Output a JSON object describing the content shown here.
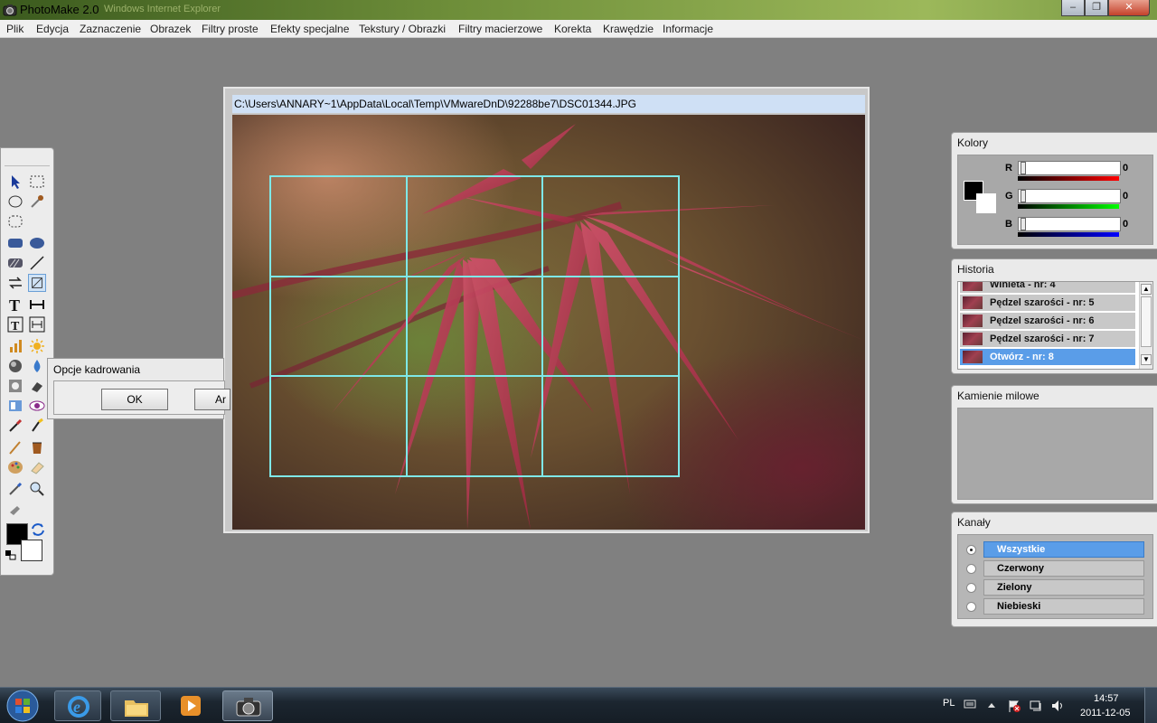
{
  "window": {
    "title": "PhotoMake 2.0",
    "ghost_text": "Windows Internet Explorer"
  },
  "menu": [
    "Plik",
    "Edycja",
    "Zaznaczenie",
    "Obrazek",
    "Filtry proste",
    "Efekty specjalne",
    "Tekstury / Obrazki",
    "Filtry macierzowe",
    "Korekta",
    "Krawędzie",
    "Informacje"
  ],
  "image_window": {
    "path": "C:\\Users\\ANNARY~1\\AppData\\Local\\Temp\\VMwareDnD\\92288be7\\DSC01344.JPG"
  },
  "crop_dialog": {
    "title": "Opcje kadrowania",
    "ok_label": "OK",
    "second_label": "Ar"
  },
  "colors_panel": {
    "title": "Kolory",
    "r_label": "R",
    "r_value": "0",
    "g_label": "G",
    "g_value": "0",
    "b_label": "B",
    "b_value": "0"
  },
  "history_panel": {
    "title": "Historia",
    "items": [
      "Winieta - nr: 4",
      "Pędzel szarości - nr: 5",
      "Pędzel szarości - nr: 6",
      "Pędzel szarości - nr: 7",
      "Otwórz - nr: 8"
    ],
    "selected_index": 4
  },
  "milestones_panel": {
    "title": "Kamienie milowe"
  },
  "channels_panel": {
    "title": "Kanały",
    "items": [
      "Wszystkie",
      "Czerwony",
      "Zielony",
      "Niebieski"
    ],
    "selected_index": 0
  },
  "taskbar": {
    "lang": "PL",
    "time": "14:57",
    "date": "2011-12-05"
  },
  "colors": {
    "selection_blue": "#5a9de8",
    "crop_grid": "#7ee8e8"
  }
}
